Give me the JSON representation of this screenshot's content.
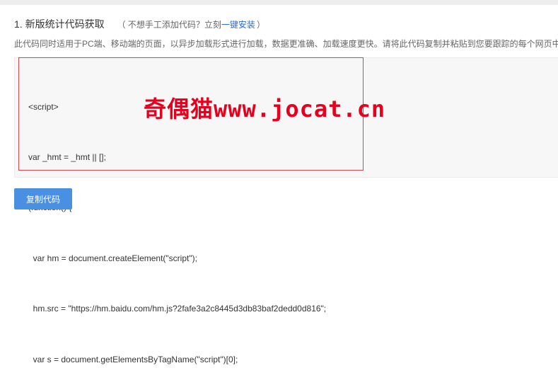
{
  "section": {
    "title": "1. 新版统计代码获取",
    "note_prefix": "（ 不想手工添加代码？立刻",
    "note_link": "一键安装",
    "note_suffix": "）",
    "description": "此代码同时适用于PC端、移动端的页面，以异步加载形式进行加载，数据更准确、加载速度更快。请将此代码复制并粘贴到您要跟踪的每个网页中"
  },
  "code": {
    "lines": [
      "<script>",
      "var _hmt = _hmt || [];",
      "(function() {",
      "  var hm = document.createElement(\"script\");",
      "  hm.src = \"https://hm.baidu.com/hm.js?2fafe3a2c8445d3db83baf2dedd0d816\";",
      "  var s = document.getElementsByTagName(\"script\")[0];"
    ]
  },
  "watermark": "奇偶猫www.jocat.cn",
  "actions": {
    "copy_label": "复制代码"
  },
  "colors": {
    "accent": "#4a90e2",
    "link": "#2b6bd3",
    "highlight_border": "#d9434a",
    "watermark": "#e5001e"
  }
}
